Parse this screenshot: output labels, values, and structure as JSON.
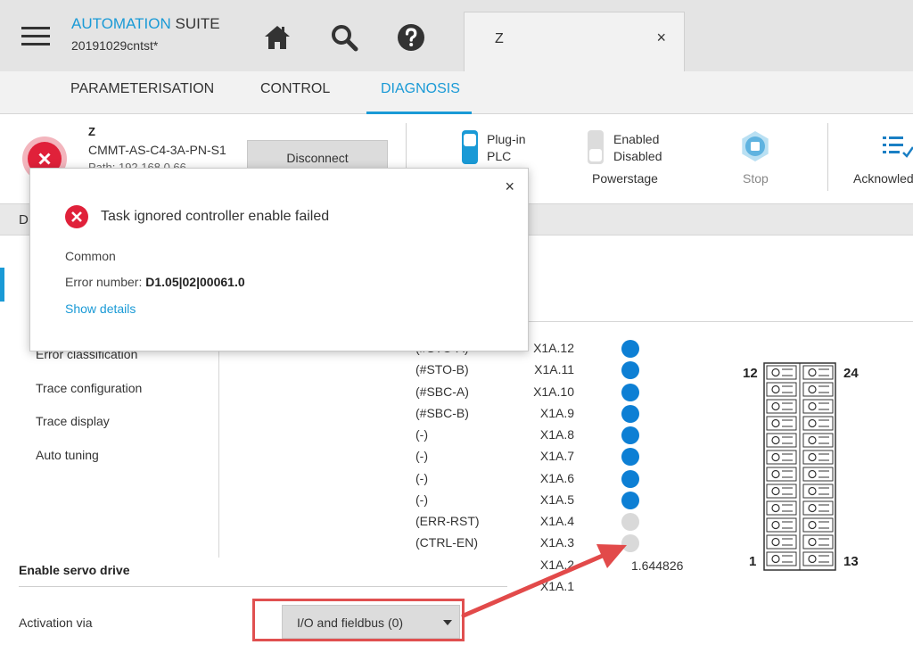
{
  "app": {
    "brand": "AUTOMATION",
    "suite": " SUITE",
    "project": "20191029cntst*"
  },
  "toolbar": {
    "icons": [
      "home-icon",
      "search-icon",
      "help-icon"
    ]
  },
  "tab": {
    "label": "Z",
    "close": "×"
  },
  "nav": {
    "tabs": [
      {
        "label": "PARAMETERISATION"
      },
      {
        "label": "CONTROL"
      },
      {
        "label": "DIAGNOSIS"
      }
    ],
    "active": "DIAGNOSIS"
  },
  "device": {
    "name": "Z",
    "model": "CMMT-AS-C4-3A-PN-S1",
    "path": "Path: 192.168.0.66",
    "disconnect_label": "Disconnect",
    "control_source": {
      "option1": "Plug-in",
      "option2": "PLC"
    },
    "powerstage": {
      "enabled": "Enabled",
      "disabled": "Disabled",
      "label": "Powerstage"
    },
    "stop_label": "Stop",
    "acknowledge_label": "Acknowled"
  },
  "section": {
    "label": "D"
  },
  "left_nav": {
    "items": [
      {
        "label": "Error classification"
      },
      {
        "label": "Trace configuration"
      },
      {
        "label": "Trace display"
      },
      {
        "label": "Auto tuning"
      }
    ]
  },
  "io": {
    "rows": [
      {
        "signal": "(#STO-A)",
        "pin": "X1A.12",
        "state": "on"
      },
      {
        "signal": "(#STO-B)",
        "pin": "X1A.11",
        "state": "on"
      },
      {
        "signal": "(#SBC-A)",
        "pin": "X1A.10",
        "state": "on"
      },
      {
        "signal": "(#SBC-B)",
        "pin": "X1A.9",
        "state": "on"
      },
      {
        "signal": "(-)",
        "pin": "X1A.8",
        "state": "on"
      },
      {
        "signal": "(-)",
        "pin": "X1A.7",
        "state": "on"
      },
      {
        "signal": "(-)",
        "pin": "X1A.6",
        "state": "on"
      },
      {
        "signal": "(-)",
        "pin": "X1A.5",
        "state": "on"
      },
      {
        "signal": "(ERR-RST)",
        "pin": "X1A.4",
        "state": "off"
      },
      {
        "signal": "(CTRL-EN)",
        "pin": "X1A.3",
        "state": "off"
      },
      {
        "signal": "",
        "pin": "X1A.2",
        "state": "none"
      },
      {
        "signal": "",
        "pin": "X1A.1",
        "state": "none"
      }
    ],
    "analog_value": "1.644826",
    "terminal_labels": {
      "top_left": "12",
      "top_right": "24",
      "bottom_left": "1",
      "bottom_right": "13"
    }
  },
  "form": {
    "title": "Enable servo drive",
    "activation_label": "Activation via",
    "activation_value": "I/O and fieldbus (0)"
  },
  "popup": {
    "title": "Task ignored controller enable failed",
    "category": "Common",
    "error_label": "Error number: ",
    "error_number": "D1.05|02|00061.0",
    "details_link": "Show details",
    "close": "×"
  },
  "colors": {
    "accent": "#1a9ad6",
    "led_on": "#0d7fd4",
    "led_off": "#d9d9d9",
    "error": "#e0213a",
    "highlight": "#e05050"
  }
}
